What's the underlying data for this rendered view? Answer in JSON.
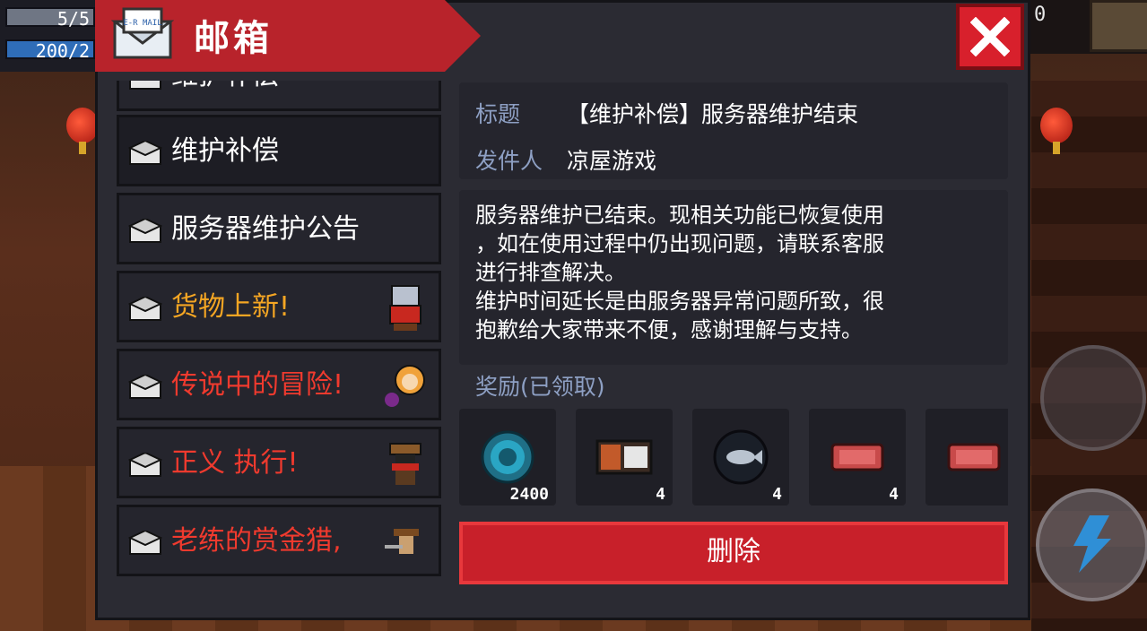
{
  "hud": {
    "armor_text": "5/5",
    "energy_text": "200/2",
    "right_counter": "0"
  },
  "header": {
    "title": "邮箱",
    "mail_icon_text": "E-R MAIL"
  },
  "mail_list": [
    {
      "label": "维护补偿",
      "color": "#ffffff",
      "partial": true
    },
    {
      "label": "维护补偿",
      "color": "#ffffff",
      "selected": true
    },
    {
      "label": "服务器维护公告",
      "color": "#ffffff"
    },
    {
      "label": "货物上新!",
      "color": "#f5a623",
      "thumb": "merchant-icon"
    },
    {
      "label": "传说中的冒险!",
      "color": "#f03a2e",
      "thumb": "hero-girl-icon"
    },
    {
      "label": "正义 执行!",
      "color": "#f03a2e",
      "thumb": "bandit-icon"
    },
    {
      "label": "老练的赏金猎,",
      "color": "#f03a2e",
      "thumb": "bounty-hunter-icon"
    }
  ],
  "detail": {
    "title_label": "标题",
    "title_value": "【维护补偿】服务器维护结束",
    "sender_label": "发件人",
    "sender_value": "凉屋游戏",
    "body": "服务器维护已结束。现相关功能已恢复使用\n，如在使用过程中仍出现问题，请联系客服\n进行排查解决。\n维护时间延长是由服务器异常问题所致，很\n抱歉给大家带来不便，感谢理解与支持。",
    "reward_title": "奖励(已领取)",
    "rewards": [
      {
        "icon": "gem-coin-icon",
        "qty": "2400"
      },
      {
        "icon": "er-card-icon",
        "qty": "4"
      },
      {
        "icon": "fish-can-icon",
        "qty": "4"
      },
      {
        "icon": "ticket-icon",
        "qty": "4"
      },
      {
        "icon": "ticket-icon",
        "qty": "("
      }
    ],
    "delete_label": "删除"
  },
  "colors": {
    "panel": "#2b2b33",
    "header_red": "#b8232b",
    "label_blue": "#8ea0c4",
    "delete_red": "#c8202a"
  }
}
